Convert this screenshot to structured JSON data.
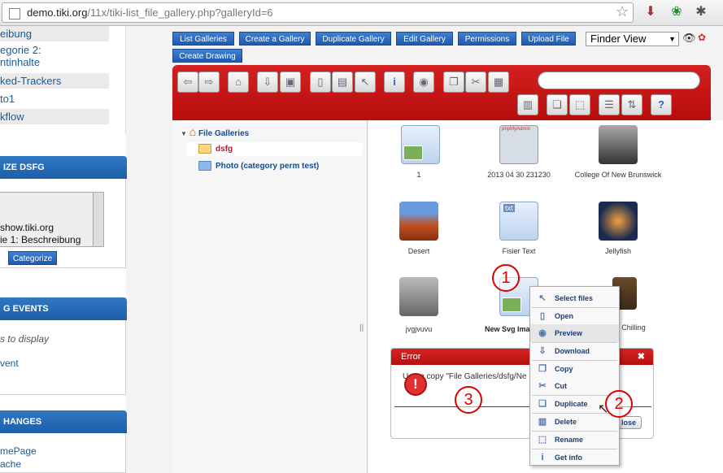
{
  "browser": {
    "url_host": "demo.tiki.org",
    "url_path": "/11x/tiki-list_file_gallery.php?galleryId=6"
  },
  "sidebar": {
    "links": [
      "eibung",
      "egorie 2:",
      "ntinhalte",
      "ked-Trackers",
      "to1",
      "kflow"
    ],
    "categorize_title": "IZE DSFG",
    "categorize_list": [
      "show.tiki.org",
      "ie 1: Beschreibung"
    ],
    "categorize_button": "Categorize",
    "events_title": "G EVENTS",
    "events_empty": "s to display",
    "events_link": "vent",
    "changes_title": "HANGES",
    "changes_links": [
      "mePage",
      "ache"
    ]
  },
  "toolbar": {
    "buttons": [
      "List Galleries",
      "Create a Gallery",
      "Duplicate Gallery",
      "Edit Gallery",
      "Permissions",
      "Upload File",
      "Create Drawing"
    ],
    "view_select": "Finder View"
  },
  "tree": {
    "root": "File Galleries",
    "children": [
      "dsfg",
      "Photo (category perm test)"
    ],
    "handle": "||"
  },
  "files": [
    {
      "name": "1"
    },
    {
      "name": "2013 04 30 231230"
    },
    {
      "name": "College Of New Brunswick"
    },
    {
      "name": "Desert"
    },
    {
      "name": "Fisier Text"
    },
    {
      "name": "Jellyfish"
    },
    {
      "name": "jvgjvuvu"
    },
    {
      "name": "New Svg Image"
    },
    {
      "name": "Chilling"
    }
  ],
  "thumb_text": {
    "phpmyadmin": "phpMyAdmin",
    "txt": "txt"
  },
  "error": {
    "title": "Error",
    "close_x": "✖",
    "message": "U    to copy \"File Galleries/dsfg/Ne",
    "close_button": "lose"
  },
  "context_menu": [
    {
      "label": "Select files",
      "icon": "cursor-icon"
    },
    {
      "label": "Open",
      "icon": "open-icon"
    },
    {
      "label": "Preview",
      "icon": "eye-icon"
    },
    {
      "label": "Download",
      "icon": "download-icon"
    },
    {
      "label": "Copy",
      "icon": "copy-icon"
    },
    {
      "label": "Cut",
      "icon": "scissors-icon"
    },
    {
      "label": "Duplicate",
      "icon": "duplicate-icon"
    },
    {
      "label": "Delete",
      "icon": "delete-icon"
    },
    {
      "label": "Rename",
      "icon": "rename-icon"
    },
    {
      "label": "Get info",
      "icon": "info-icon"
    }
  ],
  "annotations": [
    "1",
    "2",
    "3"
  ],
  "colors": {
    "accent_red": "#c41414",
    "button_blue": "#2f6cc0",
    "link_blue": "#1a5b97"
  }
}
